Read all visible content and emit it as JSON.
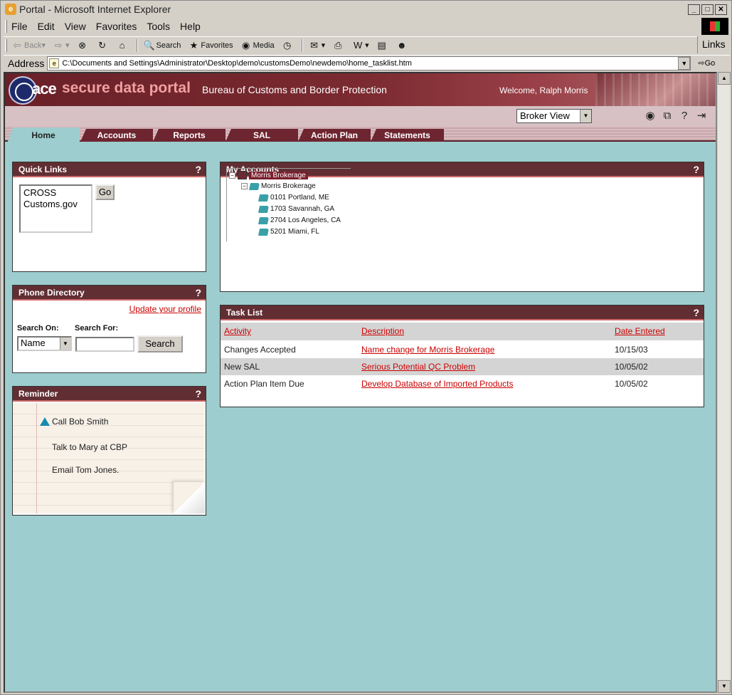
{
  "window": {
    "title": "Portal - Microsoft Internet Explorer",
    "menu": [
      "File",
      "Edit",
      "View",
      "Favorites",
      "Tools",
      "Help"
    ],
    "toolbar": {
      "back": "Back",
      "search": "Search",
      "favorites": "Favorites",
      "media": "Media"
    },
    "links_label": "Links",
    "address_label": "Address",
    "address": "C:\\Documents and Settings\\Administrator\\Desktop\\demo\\customsDemo\\newdemo\\home_tasklist.htm",
    "go_label": "Go"
  },
  "header": {
    "ace": "ace",
    "portal": "secure data portal",
    "bureau": "Bureau of Customs and Border Protection",
    "welcome": "Welcome, Ralph Morris",
    "view_select": "Broker View"
  },
  "tabs": [
    "Home",
    "Accounts",
    "Reports",
    "SAL",
    "Action Plan",
    "Statements"
  ],
  "quick_links": {
    "title": "Quick Links",
    "help": "?",
    "options": [
      "CROSS",
      "Customs.gov"
    ],
    "go": "Go"
  },
  "phone_directory": {
    "title": "Phone Directory",
    "help": "?",
    "update_link": "Update your profile",
    "search_on_label": "Search On:",
    "search_for_label": "Search For:",
    "search_on_value": "Name",
    "search_button": "Search"
  },
  "reminder": {
    "title": "Reminder",
    "help": "?",
    "items": [
      "Call Bob Smith",
      "Talk to Mary at CBP",
      "Email Tom Jones."
    ]
  },
  "my_accounts": {
    "title": "My Accounts",
    "help": "?",
    "root": "Morris Brokerage",
    "child": "Morris Brokerage",
    "ports": [
      "0101 Portland, ME",
      "1703 Savannah, GA",
      "2704 Los Angeles, CA",
      "5201 Miami, FL"
    ]
  },
  "task_list": {
    "title": "Task List",
    "help": "?",
    "columns": [
      "Activity",
      "Description",
      "Date Entered"
    ],
    "rows": [
      [
        "Changes Accepted",
        "Name change for Morris Brokerage",
        "10/15/03"
      ],
      [
        "New SAL",
        "Serious Potential QC Problem",
        "10/05/02"
      ],
      [
        "Action Plan Item Due",
        "Develop Database of Imported Products",
        "10/05/02"
      ]
    ]
  }
}
